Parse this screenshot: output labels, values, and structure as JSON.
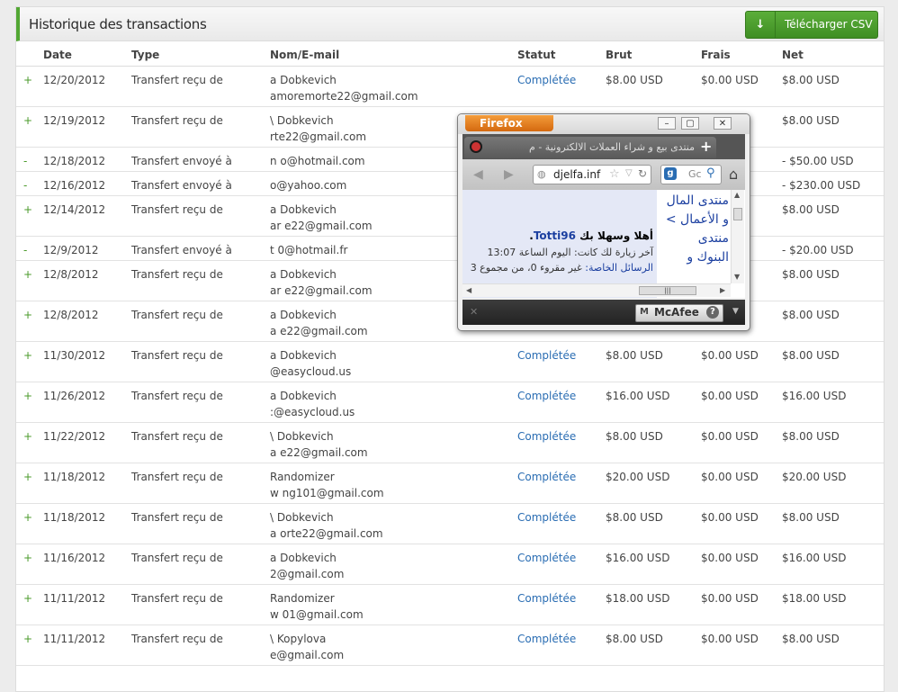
{
  "header": {
    "title": "Historique des transactions",
    "csv_button": "Télécharger CSV",
    "csv_icon": "↓"
  },
  "columns": [
    "Date",
    "Type",
    "Nom/E-mail",
    "Statut",
    "Brut",
    "Frais",
    "Net"
  ],
  "rows": [
    {
      "sign": "+",
      "date": "12/20/2012",
      "type": "Transfert reçu de",
      "name": "a Dobkevich",
      "email": "amoremorte22@gmail.com",
      "status": "Complétée",
      "brut": "$8.00 USD",
      "frais": "$0.00 USD",
      "net": "$8.00 USD"
    },
    {
      "sign": "+",
      "date": "12/19/2012",
      "type": "Transfert reçu de",
      "name": "\\ Dobkevich",
      "email": "rte22@gmail.com",
      "status": "",
      "brut": "",
      "frais": "",
      "net": "$8.00 USD"
    },
    {
      "sign": "-",
      "date": "12/18/2012",
      "type": "Transfert envoyé à",
      "name": "n o@hotmail.com",
      "email": "",
      "status": "",
      "brut": "",
      "frais": "",
      "net": "- $50.00 USD"
    },
    {
      "sign": "-",
      "date": "12/16/2012",
      "type": "Transfert envoyé à",
      "name": "o@yahoo.com",
      "email": "",
      "status": "",
      "brut": "",
      "frais": "",
      "net": "- $230.00 USD"
    },
    {
      "sign": "+",
      "date": "12/14/2012",
      "type": "Transfert reçu de",
      "name": "a Dobkevich",
      "email": "ar e22@gmail.com",
      "status": "",
      "brut": "",
      "frais": "",
      "net": "$8.00 USD"
    },
    {
      "sign": "-",
      "date": "12/9/2012",
      "type": "Transfert envoyé à",
      "name": "t 0@hotmail.fr",
      "email": "",
      "status": "",
      "brut": "",
      "frais": "",
      "net": "- $20.00 USD"
    },
    {
      "sign": "+",
      "date": "12/8/2012",
      "type": "Transfert reçu de",
      "name": "a Dobkevich",
      "email": "ar e22@gmail.com",
      "status": "",
      "brut": "",
      "frais": "",
      "net": "$8.00 USD"
    },
    {
      "sign": "+",
      "date": "12/8/2012",
      "type": "Transfert reçu de",
      "name": "a Dobkevich",
      "email": "a e22@gmail.com",
      "status": "",
      "brut": "",
      "frais": "",
      "net": "$8.00 USD"
    },
    {
      "sign": "+",
      "date": "11/30/2012",
      "type": "Transfert reçu de",
      "name": "a Dobkevich",
      "email": "@easycloud.us",
      "status": "Complétée",
      "brut": "$8.00 USD",
      "frais": "$0.00 USD",
      "net": "$8.00 USD"
    },
    {
      "sign": "+",
      "date": "11/26/2012",
      "type": "Transfert reçu de",
      "name": "a Dobkevich",
      "email": ":@easycloud.us",
      "status": "Complétée",
      "brut": "$16.00 USD",
      "frais": "$0.00 USD",
      "net": "$16.00 USD"
    },
    {
      "sign": "+",
      "date": "11/22/2012",
      "type": "Transfert reçu de",
      "name": "\\ Dobkevich",
      "email": "a e22@gmail.com",
      "status": "Complétée",
      "brut": "$8.00 USD",
      "frais": "$0.00 USD",
      "net": "$8.00 USD"
    },
    {
      "sign": "+",
      "date": "11/18/2012",
      "type": "Transfert reçu de",
      "name": "Randomizer",
      "email": "w ng101@gmail.com",
      "status": "Complétée",
      "brut": "$20.00 USD",
      "frais": "$0.00 USD",
      "net": "$20.00 USD"
    },
    {
      "sign": "+",
      "date": "11/18/2012",
      "type": "Transfert reçu de",
      "name": "\\ Dobkevich",
      "email": "a orte22@gmail.com",
      "status": "Complétée",
      "brut": "$8.00 USD",
      "frais": "$0.00 USD",
      "net": "$8.00 USD"
    },
    {
      "sign": "+",
      "date": "11/16/2012",
      "type": "Transfert reçu de",
      "name": "a Dobkevich",
      "email": "2@gmail.com",
      "status": "Complétée",
      "brut": "$16.00 USD",
      "frais": "$0.00 USD",
      "net": "$16.00 USD"
    },
    {
      "sign": "+",
      "date": "11/11/2012",
      "type": "Transfert reçu de",
      "name": "Randomizer",
      "email": "w 01@gmail.com",
      "status": "Complétée",
      "brut": "$18.00 USD",
      "frais": "$0.00 USD",
      "net": "$18.00 USD"
    },
    {
      "sign": "+",
      "date": "11/11/2012",
      "type": "Transfert reçu de",
      "name": "\\ Kopylova",
      "email": "e@gmail.com",
      "status": "Complétée",
      "brut": "$8.00 USD",
      "frais": "$0.00 USD",
      "net": "$8.00 USD"
    }
  ],
  "popup": {
    "brand": "Firefox",
    "tab_title": "منتدى بيع و شراء العملات الالكترونية - م",
    "new_tab": "+",
    "url": "djelfa.inf",
    "search_hint": "Gc",
    "greeting_prefix": "أهلا وسهلا بك",
    "username": "Totti96",
    "last_visit": "آخر زيارة لك كانت: اليوم الساعة 13:07",
    "pm_link": "الرسائل الخاصة:",
    "pm_text": "غير مقروء 0، من مجموع 3",
    "forum_link": "منتدى المال و الأعمال > منتدى البنوك و",
    "toolbar_label": "McAfee",
    "help": "?"
  }
}
